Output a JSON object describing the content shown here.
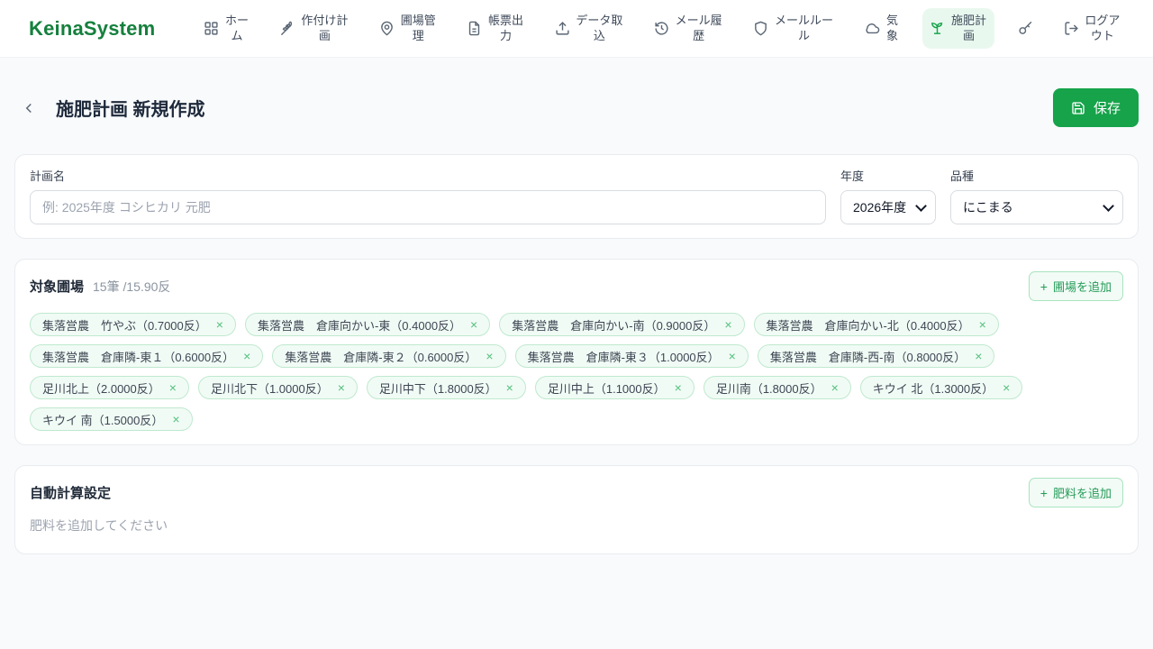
{
  "header": {
    "logo": "KeinaSystem",
    "nav": [
      {
        "label": "ホーム",
        "icon": "grid-icon",
        "active": false
      },
      {
        "label": "作付け計画",
        "icon": "wheat-icon",
        "active": false
      },
      {
        "label": "圃場管理",
        "icon": "map-pin-icon",
        "active": false
      },
      {
        "label": "帳票出力",
        "icon": "document-icon",
        "active": false
      },
      {
        "label": "データ取込",
        "icon": "upload-icon",
        "active": false
      },
      {
        "label": "メール履歴",
        "icon": "history-icon",
        "active": false
      },
      {
        "label": "メールルール",
        "icon": "shield-icon",
        "active": false
      },
      {
        "label": "気象",
        "icon": "cloud-icon",
        "active": false
      },
      {
        "label": "施肥計画",
        "icon": "sprout-icon",
        "active": true
      }
    ],
    "key_icon": "key-icon",
    "logout": {
      "label": "ログアウト",
      "icon": "logout-icon"
    }
  },
  "page": {
    "title": "施肥計画 新規作成",
    "save_label": "保存"
  },
  "form": {
    "plan_name_label": "計画名",
    "plan_name_placeholder": "例: 2025年度 コシヒカリ 元肥",
    "year_label": "年度",
    "year_value": "2026年度",
    "variety_label": "品種",
    "variety_value": "にこまる"
  },
  "fields": {
    "title": "対象圃場",
    "summary": "15筆 /15.90反",
    "add_plus": "+",
    "add_label": "圃場を追加",
    "remove_icon": "×",
    "tags": [
      {
        "label": "集落営農　竹やぶ（0.7000反）"
      },
      {
        "label": "集落営農　倉庫向かい-東（0.4000反）"
      },
      {
        "label": "集落営農　倉庫向かい-南（0.9000反）"
      },
      {
        "label": "集落営農　倉庫向かい-北（0.4000反）"
      },
      {
        "label": "集落営農　倉庫隣-東１（0.6000反）"
      },
      {
        "label": "集落営農　倉庫隣-東２（0.6000反）"
      },
      {
        "label": "集落営農　倉庫隣-東３（1.0000反）"
      },
      {
        "label": "集落営農　倉庫隣-西-南（0.8000反）"
      },
      {
        "label": "足川北上（2.0000反）"
      },
      {
        "label": "足川北下（1.0000反）"
      },
      {
        "label": "足川中下（1.8000反）"
      },
      {
        "label": "足川中上（1.1000反）"
      },
      {
        "label": "足川南（1.8000反）"
      },
      {
        "label": "キウイ 北（1.3000反）"
      },
      {
        "label": "キウイ 南（1.5000反）"
      }
    ]
  },
  "auto_calc": {
    "title": "自動計算設定",
    "add_plus": "+",
    "add_label": "肥料を追加",
    "empty_message": "肥料を追加してください"
  },
  "colors": {
    "brand_green": "#15803d",
    "primary_green": "#16a34a",
    "active_nav_bg": "#e9f8ef",
    "tag_bg": "#f1fbf5",
    "tag_border": "#bfe9cf",
    "page_bg": "#f8fafc"
  }
}
